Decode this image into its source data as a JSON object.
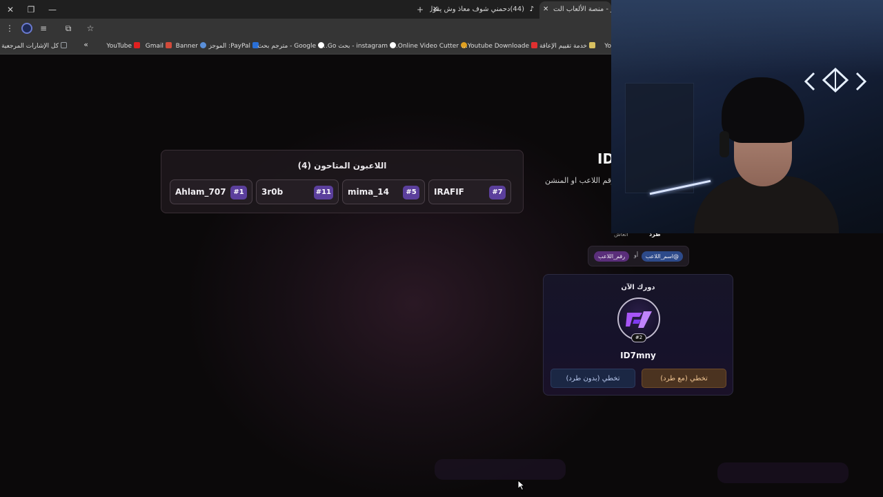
{
  "browser": {
    "window_controls": [
      "✕",
      "❐",
      "—"
    ],
    "new_tab": "+",
    "tabs": [
      {
        "title": "Jawla - منصة الألعاب الت",
        "active": true
      },
      {
        "title": "(44)دحمني شوف معاذ وش يقول...",
        "active": false
      }
    ],
    "bookmarks": [
      {
        "label": "كل الإشارات المرجعية",
        "color": "#9aa0a6"
      },
      {
        "label": "»",
        "color": ""
      },
      {
        "label": "YouTube",
        "color": "#e02020"
      },
      {
        "label": "Gmail",
        "color": "#d24a3a"
      },
      {
        "label": "Banner",
        "color": "#5a8fd8"
      },
      {
        "label": "PayPal: الموجز",
        "color": "#2a6fd6"
      },
      {
        "label": "Google - مترجم بحث",
        "color": "#cfcfcf"
      },
      {
        "label": "instagram - بحث Go...",
        "color": "#cfcfcf"
      },
      {
        "label": "Online Video Cutter...",
        "color": "#e0a020"
      },
      {
        "label": "Youtube Downloade...",
        "color": "#e03030"
      },
      {
        "label": "خدمة تقييم الإعاقة",
        "color": "#d8c060"
      },
      {
        "label": "Yo",
        "color": "#e02020"
      }
    ]
  },
  "eliminated": {
    "title": "اللاعبون المتاحون (4)",
    "players": [
      {
        "name": "IRAFIF",
        "num": "#7"
      },
      {
        "name": "mima_14",
        "num": "#5"
      },
      {
        "name": "3r0b",
        "num": "#11"
      },
      {
        "name": "Ahlam_707",
        "num": "#1"
      }
    ]
  },
  "side": {
    "id_partial": "ID",
    "hint": "رقم اللاعب او المنشن",
    "tab_kick": "طرد",
    "tab_live": "انعاش",
    "syntax_tag1": "@اسم_اللاعب",
    "syntax_or": "أو",
    "syntax_tag2": "رقم_اللاعب"
  },
  "turn": {
    "title": "دورك الآن",
    "avatar_num": "#2",
    "name": "ID7mny",
    "kick_button": "تخطي (مع طرد)",
    "nokick_button": "تخطي (بدون طرد)"
  },
  "colors": {
    "accent_purple": "#5b3f9c",
    "kick_orange": "#f4c894",
    "nokick_blue": "#b9c9ee"
  }
}
